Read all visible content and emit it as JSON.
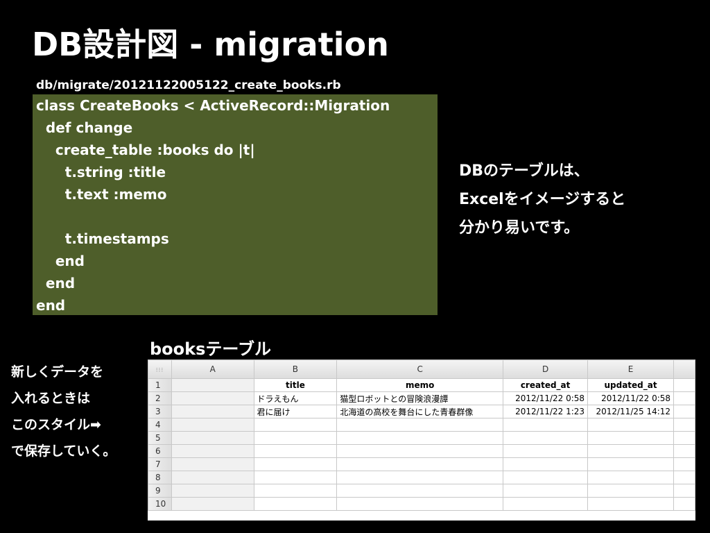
{
  "slide": {
    "title": "DB設計図 - migration",
    "file_path": "db/migrate/20121122005122_create_books.rb",
    "code_lines": [
      "class CreateBooks < ActiveRecord::Migration",
      "  def change",
      "    create_table :books do |t|",
      "      t.string :title",
      "      t.text :memo",
      "",
      "      t.timestamps",
      "    end",
      "  end",
      "end"
    ],
    "explanation_lines": [
      "DBのテーブルは、",
      "Excelをイメージすると",
      "分かり易いです。"
    ],
    "table_title": "booksテーブル",
    "side_note_lines": [
      "新しくデータを",
      "入れるときは",
      "このスタイル➡",
      "で保存していく。"
    ],
    "colors": {
      "background": "#000000",
      "code_background": "#4e5e2a",
      "text": "#ffffff"
    }
  },
  "spreadsheet": {
    "corner_icon": "grid-dots-icon",
    "column_headers": [
      "A",
      "B",
      "C",
      "D",
      "E"
    ],
    "row_numbers": [
      "1",
      "2",
      "3",
      "4",
      "5",
      "6",
      "7",
      "8",
      "9",
      "10"
    ],
    "field_names": [
      "",
      "title",
      "memo",
      "created_at",
      "updated_at"
    ],
    "records": [
      [
        "",
        "ドラえもん",
        "猫型ロボットとの冒険浪漫譚",
        "2012/11/22 0:58",
        "2012/11/22 0:58"
      ],
      [
        "",
        "君に届け",
        "北海道の高校を舞台にした青春群像",
        "2012/11/22 1:23",
        "2012/11/25 14:12"
      ]
    ]
  }
}
